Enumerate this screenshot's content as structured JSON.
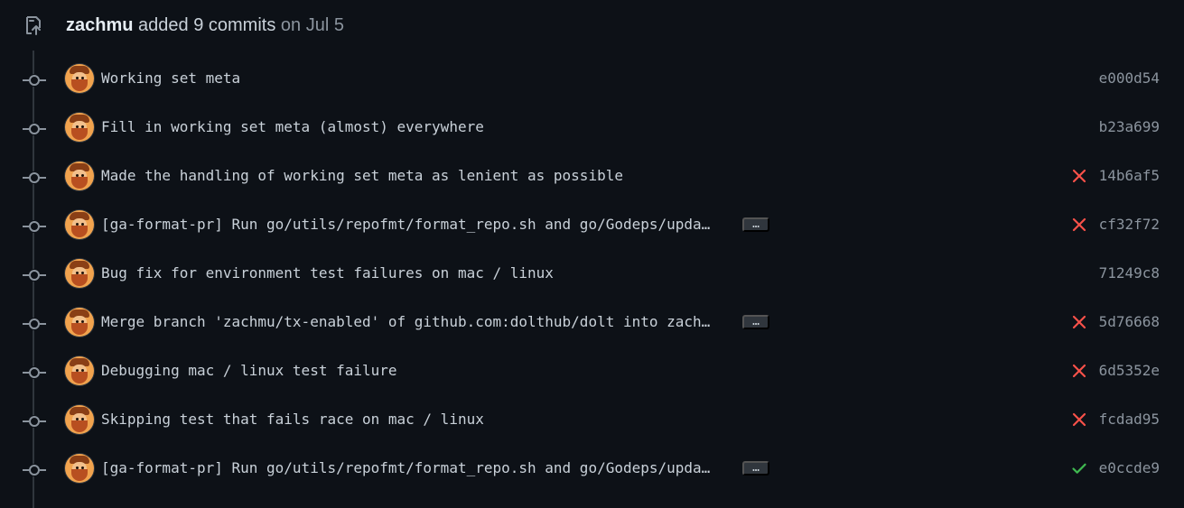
{
  "event": {
    "author": "zachmu",
    "action": "added 9 commits",
    "date": "on Jul 5",
    "icon": "repo-push-icon"
  },
  "colors": {
    "failure": "#f85149",
    "success": "#3fb950",
    "muted": "#8b949e",
    "background": "#0d1117"
  },
  "commits": [
    {
      "message": "Working set meta",
      "sha": "e000d54",
      "status": "none",
      "has_more": false
    },
    {
      "message": "Fill in working set meta (almost) everywhere",
      "sha": "b23a699",
      "status": "none",
      "has_more": false
    },
    {
      "message": "Made the handling of working set meta as lenient as possible",
      "sha": "14b6af5",
      "status": "failure",
      "has_more": false
    },
    {
      "message": "[ga-format-pr] Run go/utils/repofmt/format_repo.sh and go/Godeps/upda…",
      "sha": "cf32f72",
      "status": "failure",
      "has_more": true,
      "more_label": "…"
    },
    {
      "message": "Bug fix for environment test failures on mac / linux",
      "sha": "71249c8",
      "status": "none",
      "has_more": false
    },
    {
      "message": "Merge branch 'zachmu/tx-enabled' of github.com:dolthub/dolt into zach…",
      "sha": "5d76668",
      "status": "failure",
      "has_more": true,
      "more_label": "…"
    },
    {
      "message": "Debugging mac / linux test failure",
      "sha": "6d5352e",
      "status": "failure",
      "has_more": false
    },
    {
      "message": "Skipping test that fails race on mac / linux",
      "sha": "fcdad95",
      "status": "failure",
      "has_more": false
    },
    {
      "message": "[ga-format-pr] Run go/utils/repofmt/format_repo.sh and go/Godeps/upda…",
      "sha": "e0ccde9",
      "status": "success",
      "has_more": true,
      "more_label": "…"
    }
  ]
}
